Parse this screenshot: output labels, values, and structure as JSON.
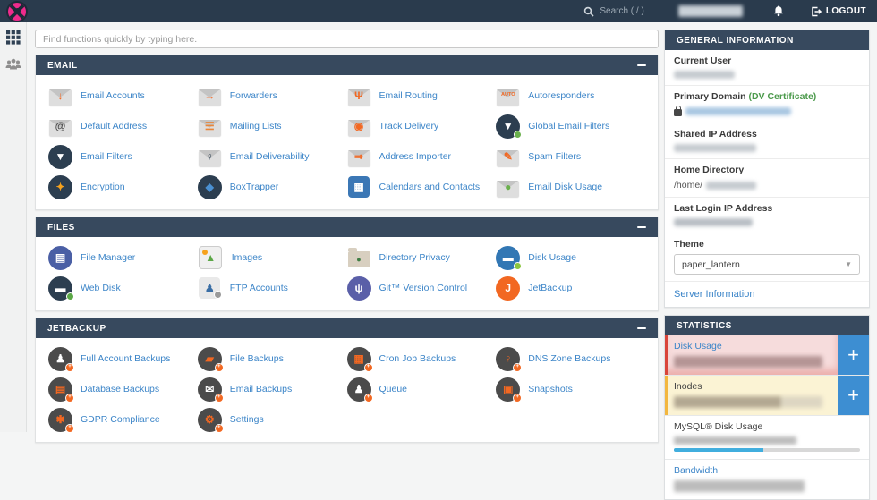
{
  "topbar": {
    "search_label": "Search ( / )",
    "logout_label": "LOGOUT",
    "user_name_blurred": true
  },
  "quick_search": {
    "placeholder": "Find functions quickly by typing here."
  },
  "colors": {
    "topbar_bg": "#2a3b4d",
    "section_header_bg": "#37495e",
    "link_blue": "#3c85c8",
    "accent_orange": "#f26822",
    "plus_button_blue": "#3d8ed2",
    "danger_bg": "#f6dcdc",
    "danger_border": "#d9453a",
    "warning_bg": "#fbf3d4",
    "warning_border": "#f3b73f",
    "progress_blue": "#41aede"
  },
  "sections": [
    {
      "id": "email",
      "title": "EMAIL",
      "items": [
        {
          "label": "Email Accounts",
          "icon": {
            "shape": "envelope",
            "glyph": "↓",
            "fg": "#f26822"
          }
        },
        {
          "label": "Forwarders",
          "icon": {
            "shape": "envelope",
            "glyph": "→",
            "fg": "#f26822"
          }
        },
        {
          "label": "Email Routing",
          "icon": {
            "shape": "envelope",
            "glyph": "Ψ",
            "fg": "#f26822"
          }
        },
        {
          "label": "Autoresponders",
          "icon": {
            "shape": "envelope",
            "glyph": "AUTO",
            "fg": "#f26822",
            "gs": "5.5px"
          }
        },
        {
          "label": "Default Address",
          "icon": {
            "shape": "envelope",
            "glyph": "@",
            "fg": "#4a4a4a"
          }
        },
        {
          "label": "Mailing Lists",
          "icon": {
            "shape": "envelope",
            "glyph": "☰",
            "fg": "#e8863a"
          }
        },
        {
          "label": "Track Delivery",
          "icon": {
            "shape": "envelope",
            "glyph": "◉",
            "fg": "#f26822"
          }
        },
        {
          "label": "Global Email Filters",
          "icon": {
            "shape": "circle",
            "bg": "#2c3e50",
            "glyph": "▼",
            "fg": "#ffffff",
            "dot": "#6ab04c"
          }
        },
        {
          "label": "Email Filters",
          "icon": {
            "shape": "circle",
            "bg": "#2c3e50",
            "glyph": "▼",
            "fg": "#ffffff"
          }
        },
        {
          "label": "Email Deliverability",
          "icon": {
            "shape": "envelope",
            "glyph": "♀",
            "fg": "#2c3e50"
          }
        },
        {
          "label": "Address Importer",
          "icon": {
            "shape": "envelope",
            "glyph": "⇒",
            "fg": "#f26822"
          }
        },
        {
          "label": "Spam Filters",
          "icon": {
            "shape": "envelope",
            "glyph": "✎",
            "fg": "#f26822"
          }
        },
        {
          "label": "Encryption",
          "icon": {
            "shape": "circle",
            "bg": "#2c3e50",
            "glyph": "✦",
            "fg": "#f6a21d"
          }
        },
        {
          "label": "BoxTrapper",
          "icon": {
            "shape": "circle",
            "bg": "#2c3e50",
            "glyph": "◆",
            "fg": "#4a90d2"
          }
        },
        {
          "label": "Calendars and Contacts",
          "icon": {
            "shape": "square",
            "bg": "#3b77b5",
            "glyph": "▦",
            "fg": "#ffffff"
          }
        },
        {
          "label": "Email Disk Usage",
          "icon": {
            "shape": "envelope",
            "glyph": "●",
            "fg": "#6ab04c"
          }
        }
      ]
    },
    {
      "id": "files",
      "title": "FILES",
      "items": [
        {
          "label": "File Manager",
          "icon": {
            "shape": "circle",
            "bg": "#4a5fa5",
            "glyph": "▤",
            "fg": "#ffffff"
          }
        },
        {
          "label": "Images",
          "icon": {
            "shape": "square",
            "bg": "#f0f0f0",
            "glyph": "▲",
            "fg": "#5ba746",
            "dot_tl": "#f6a21d",
            "border": "#cccccc"
          }
        },
        {
          "label": "Directory Privacy",
          "icon": {
            "shape": "folder",
            "glyph": "●",
            "fg": "#3f7d44",
            "gs": "9px"
          }
        },
        {
          "label": "Disk Usage",
          "icon": {
            "shape": "circle",
            "bg": "#3277b4",
            "glyph": "▬",
            "fg": "#ffffff",
            "dot": "#8cc63f"
          }
        },
        {
          "label": "Web Disk",
          "icon": {
            "shape": "circle",
            "bg": "#2c3e50",
            "glyph": "▬",
            "fg": "#ffffff",
            "dot": "#5ba746"
          }
        },
        {
          "label": "FTP Accounts",
          "icon": {
            "shape": "square",
            "bg": "#e9e9e9",
            "glyph": "♟",
            "fg": "#3a6ea5",
            "dot": "#9a9a9a"
          }
        },
        {
          "label": "Git™ Version Control",
          "icon": {
            "shape": "circle",
            "bg": "#5a5fa8",
            "glyph": "ψ",
            "fg": "#ffffff"
          }
        },
        {
          "label": "JetBackup",
          "icon": {
            "shape": "circle",
            "bg": "#f26822",
            "glyph": "J",
            "fg": "#ffffff"
          }
        }
      ]
    },
    {
      "id": "jetbackup",
      "title": "JETBACKUP",
      "items": [
        {
          "label": "Full Account Backups",
          "icon": {
            "shape": "circle",
            "bg": "#4b4b4b",
            "glyph": "♟",
            "fg": "#ffffff",
            "badge": true
          }
        },
        {
          "label": "File Backups",
          "icon": {
            "shape": "circle",
            "bg": "#4b4b4b",
            "glyph": "▰",
            "fg": "#f26822",
            "badge": true
          }
        },
        {
          "label": "Cron Job Backups",
          "icon": {
            "shape": "circle",
            "bg": "#4b4b4b",
            "glyph": "▦",
            "fg": "#f26822",
            "badge": true
          }
        },
        {
          "label": "DNS Zone Backups",
          "icon": {
            "shape": "circle",
            "bg": "#4b4b4b",
            "glyph": "♀",
            "fg": "#f26822",
            "badge": true
          }
        },
        {
          "label": "Database Backups",
          "icon": {
            "shape": "circle",
            "bg": "#4b4b4b",
            "glyph": "▤",
            "fg": "#f26822",
            "badge": true
          }
        },
        {
          "label": "Email Backups",
          "icon": {
            "shape": "circle",
            "bg": "#4b4b4b",
            "glyph": "✉",
            "fg": "#ffffff",
            "badge": true
          }
        },
        {
          "label": "Queue",
          "icon": {
            "shape": "circle",
            "bg": "#4b4b4b",
            "glyph": "♟",
            "fg": "#ffffff",
            "badge": true
          }
        },
        {
          "label": "Snapshots",
          "icon": {
            "shape": "circle",
            "bg": "#4b4b4b",
            "glyph": "▣",
            "fg": "#f26822",
            "badge": true
          }
        },
        {
          "label": "GDPR Compliance",
          "icon": {
            "shape": "circle",
            "bg": "#4b4b4b",
            "glyph": "✱",
            "fg": "#f26822",
            "badge": true
          }
        },
        {
          "label": "Settings",
          "icon": {
            "shape": "circle",
            "bg": "#4b4b4b",
            "glyph": "⚙",
            "fg": "#f26822",
            "badge": true
          }
        }
      ]
    }
  ],
  "general_information": {
    "title": "GENERAL INFORMATION",
    "rows": [
      {
        "label": "Current User",
        "value_blurred": true,
        "blur_width": 68,
        "blur_color": "#c6cbd0"
      },
      {
        "label": "Primary Domain",
        "suffix": "(DV Certificate)",
        "lock": true,
        "value_blurred": true,
        "blur_width": 118,
        "blur_color": "#a9c7e2"
      },
      {
        "label": "Shared IP Address",
        "value_blurred": true,
        "blur_width": 92,
        "blur_color": "#c6cbd0"
      },
      {
        "label": "Home Directory",
        "prefix": "/home/",
        "value_blurred": true,
        "blur_width": 56,
        "blur_color": "#c6cbd0"
      },
      {
        "label": "Last Login IP Address",
        "value_blurred": true,
        "blur_width": 88,
        "blur_color": "#b9bfc5"
      }
    ],
    "theme": {
      "label": "Theme",
      "value": "paper_lantern"
    },
    "server_link": "Server Information"
  },
  "statistics": {
    "title": "STATISTICS",
    "items": [
      {
        "label": "Disk Usage",
        "link": true,
        "style": "danger",
        "plus": true,
        "value_blurred": true,
        "blob_width_pct": 96,
        "blob_color": "#b59595"
      },
      {
        "label": "Inodes",
        "link": false,
        "style": "warning",
        "plus": true,
        "value_blurred": true,
        "blob_width_pct": 96,
        "blob_color": "#b3a892",
        "blob_split_pct": 72,
        "blob_color2": "#ddd6c2"
      },
      {
        "label": "MySQL® Disk Usage",
        "link": false,
        "style": "plain",
        "plus": false,
        "value_blurred": true,
        "blob_width_pct": 66,
        "blob_color": "#bcbcbc",
        "progress_pct": 48
      },
      {
        "label": "Bandwidth",
        "link": true,
        "style": "plain",
        "plus": false,
        "value_blurred": true,
        "blob_width_pct": 70,
        "blob_color": "#bcbcbc"
      }
    ]
  }
}
